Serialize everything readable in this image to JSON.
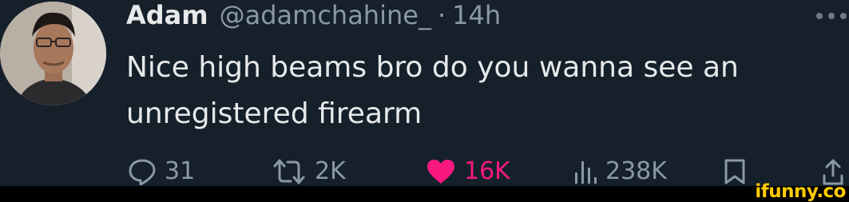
{
  "tweet": {
    "author_name": "Adam",
    "handle": "@adamchahine_",
    "separator": "·",
    "time": "14h",
    "text": "Nice high beams bro do you wanna see an unregistered firearm"
  },
  "actions": {
    "replies": "31",
    "reposts": "2K",
    "likes": "16K",
    "views": "238K"
  },
  "icons": {
    "reply": "reply-icon",
    "repost": "repost-icon",
    "like": "heart-icon",
    "views": "views-icon",
    "bookmark": "bookmark-icon",
    "share": "share-icon",
    "more": "more-icon"
  },
  "colors": {
    "background": "#15202b",
    "text_primary": "#e7e9ea",
    "text_secondary": "#8b98a5",
    "like_active": "#f91880",
    "watermark": "#ffcc00"
  },
  "watermark": {
    "text": "ifunny.co"
  }
}
